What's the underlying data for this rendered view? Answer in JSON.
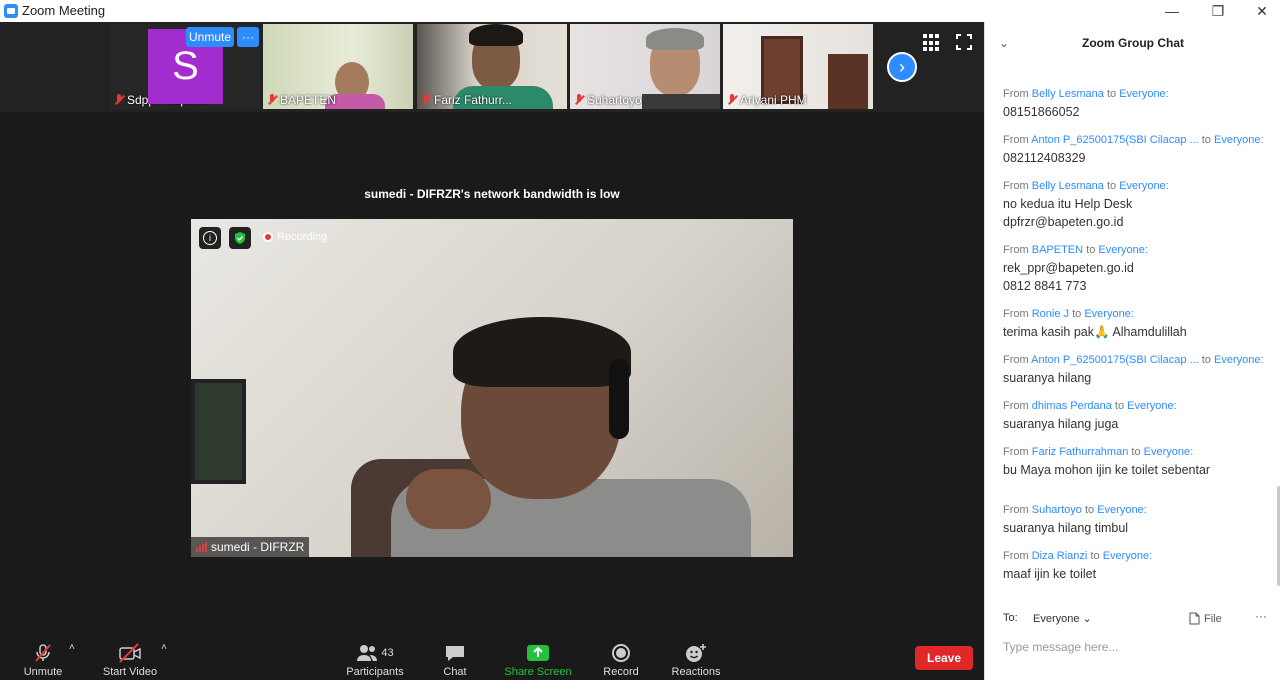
{
  "window": {
    "title": "Zoom Meeting",
    "minimize": "—",
    "restore": "❐",
    "close": "✕"
  },
  "thumbnails": [
    {
      "name": "Sdppfr Bapet..."
    },
    {
      "name": "BAPETEN"
    },
    {
      "name": "Fariz Fathurr..."
    },
    {
      "name": "Suhartoyo"
    },
    {
      "name": "Ariyani PHM"
    }
  ],
  "avatar_letter": "S",
  "thumb_overlay": {
    "unmute_label": "Unmute",
    "more_label": "···"
  },
  "next_page_label": "›",
  "network_notice": "sumedi - DIFRZR's network bandwidth is low",
  "main_video": {
    "info_label": "i",
    "recording_label": "Recording",
    "speaker_name": "sumedi - DIFRZR"
  },
  "toolbar": {
    "unmute": "Unmute",
    "start_video": "Start Video",
    "participants": "Participants",
    "participant_count": "43",
    "chat": "Chat",
    "share_screen": "Share Screen",
    "record": "Record",
    "reactions": "Reactions",
    "leave": "Leave",
    "caret": "˄"
  },
  "chat": {
    "title": "Zoom Group Chat",
    "collapse": "⌄",
    "from_label": "From",
    "to_word": "to",
    "messages": [
      {
        "from": "Belly Lesmana",
        "to": "Everyone:",
        "text": [
          "08151866052"
        ]
      },
      {
        "from": "Anton P_62500175(SBI Cilacap ...",
        "to": "Everyone:",
        "text": [
          "082112408329"
        ]
      },
      {
        "from": "Belly Lesmana",
        "to": "Everyone:",
        "text": [
          "no kedua itu Help Desk",
          "dpfrzr@bapeten.go.id"
        ]
      },
      {
        "from": "BAPETEN",
        "to": "Everyone:",
        "text": [
          "rek_ppr@bapeten.go.id",
          "0812 8841 773"
        ]
      },
      {
        "from": "Ronie J",
        "to": "Everyone:",
        "text": [
          "terima kasih pak🙏 Alhamdulillah"
        ]
      },
      {
        "from": "Anton P_62500175(SBI Cilacap ...",
        "to": "Everyone:",
        "text": [
          "suaranya hilang"
        ]
      },
      {
        "from": "dhimas Perdana",
        "to": "Everyone:",
        "text": [
          "suaranya hilang juga"
        ]
      },
      {
        "from": "Fariz Fathurrahman",
        "to": "Everyone:",
        "text": [
          "bu Maya mohon ijin ke toilet sebentar"
        ]
      },
      {
        "from": "Suhartoyo",
        "to": "Everyone:",
        "text": [
          "suaranya hilang timbul"
        ]
      },
      {
        "from": "Diza Rianzi",
        "to": "Everyone:",
        "text": [
          "maaf ijin ke toilet"
        ]
      }
    ],
    "to_label": "To:",
    "recipient": "Everyone ⌄",
    "file_label": "File",
    "more_label": "···",
    "input_placeholder": "Type message here..."
  },
  "colors": {
    "accent": "#2d8cff",
    "leave": "#e02828",
    "share_screen": "#25c13c",
    "avatar": "#a32ccf"
  }
}
